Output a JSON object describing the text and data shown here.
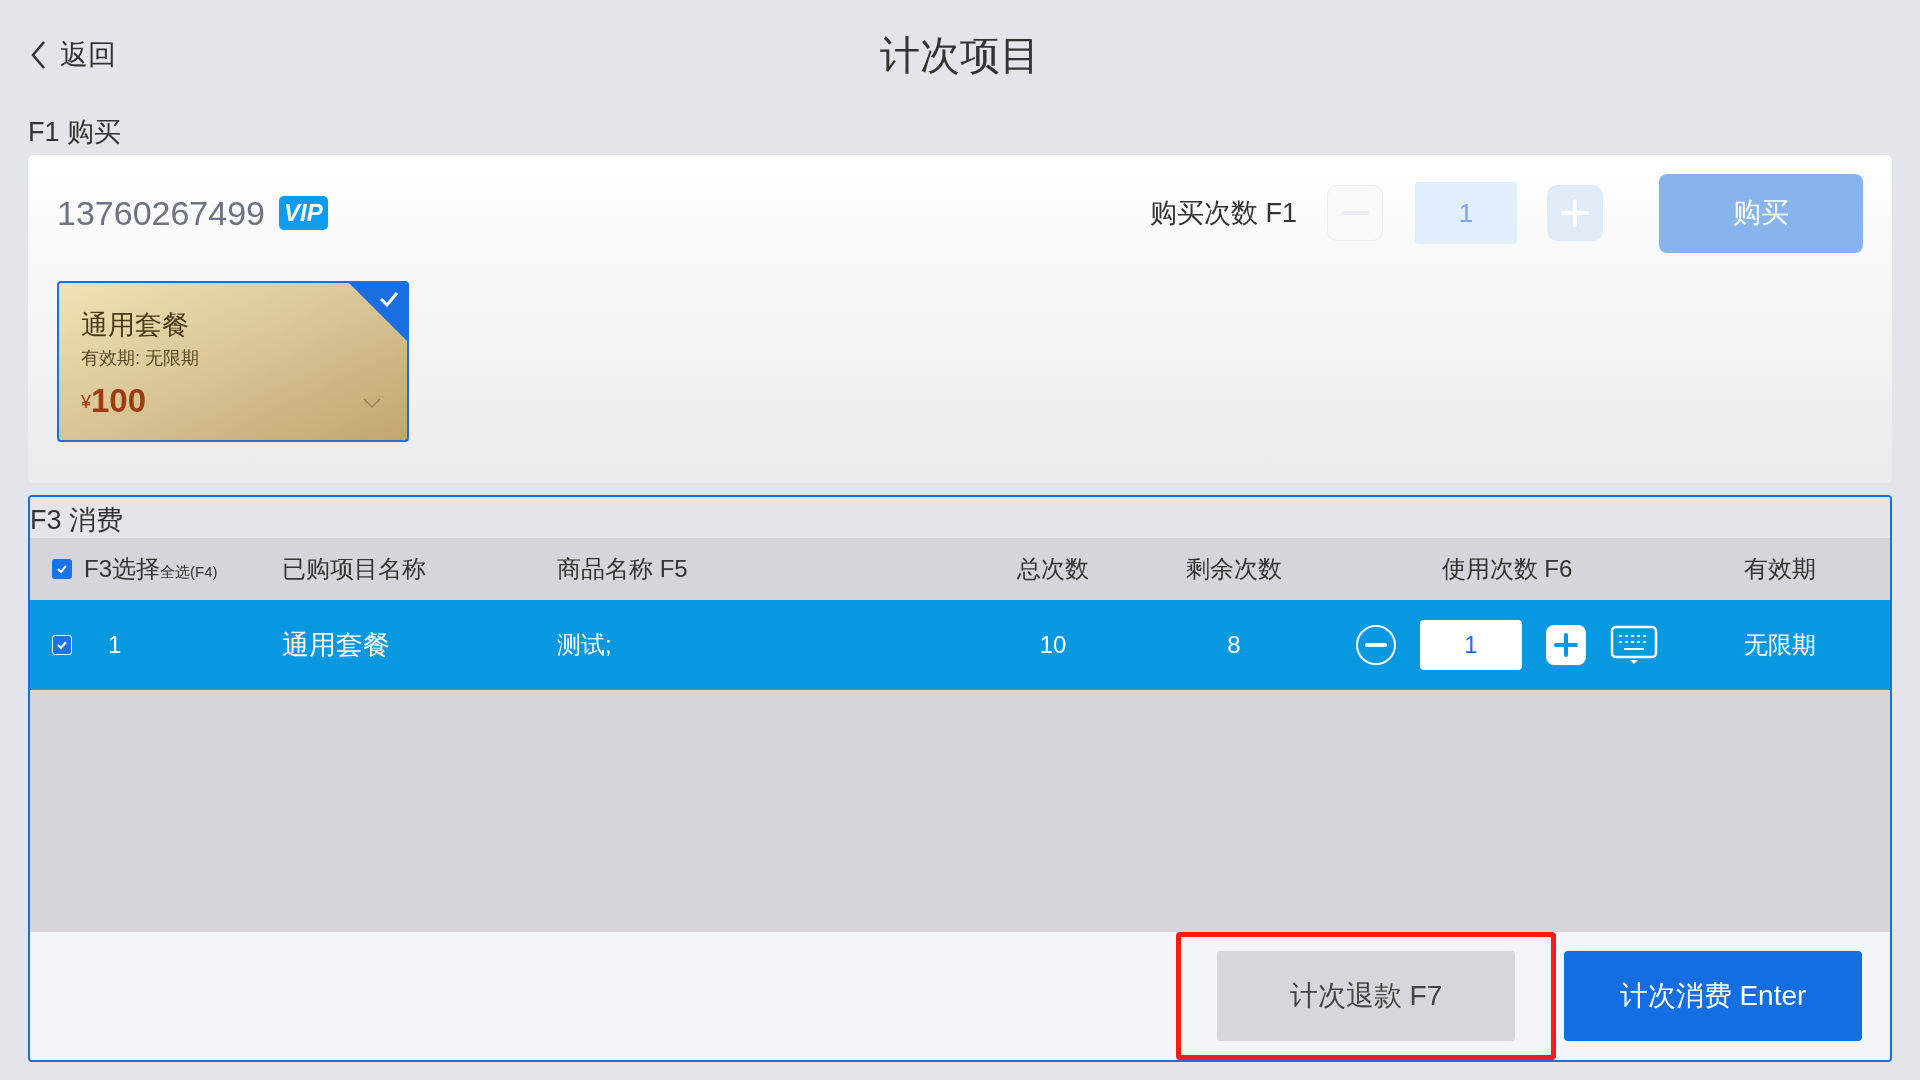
{
  "header": {
    "back": "返回",
    "title": "计次项目"
  },
  "purchase": {
    "section_title": "F1 购买",
    "phone": "13760267499",
    "vip_badge": "VIP",
    "quantity_label": "购买次数 F1",
    "quantity": "1",
    "buy_button": "购买",
    "buy_disabled": true,
    "packages": [
      {
        "name": "通用套餐",
        "validity": "有效期: 无限期",
        "currency": "¥",
        "price": "100",
        "selected": true
      }
    ]
  },
  "consume": {
    "section_title": "F3 消费",
    "columns": {
      "select": "F3选择",
      "select_all": "全选(F4)",
      "name": "已购项目名称",
      "product": "商品名称 F5",
      "total": "总次数",
      "remaining": "剩余次数",
      "usage": "使用次数 F6",
      "validity": "有效期"
    },
    "all_checked": true,
    "rows": [
      {
        "index": "1",
        "name": "通用套餐",
        "product": "测试;",
        "total": "10",
        "remaining": "8",
        "usage": "1",
        "validity": "无限期",
        "checked": true,
        "selected": true
      }
    ],
    "refund_button": "计次退款 F7",
    "refund_highlighted": true,
    "consume_button": "计次消费 Enter"
  }
}
